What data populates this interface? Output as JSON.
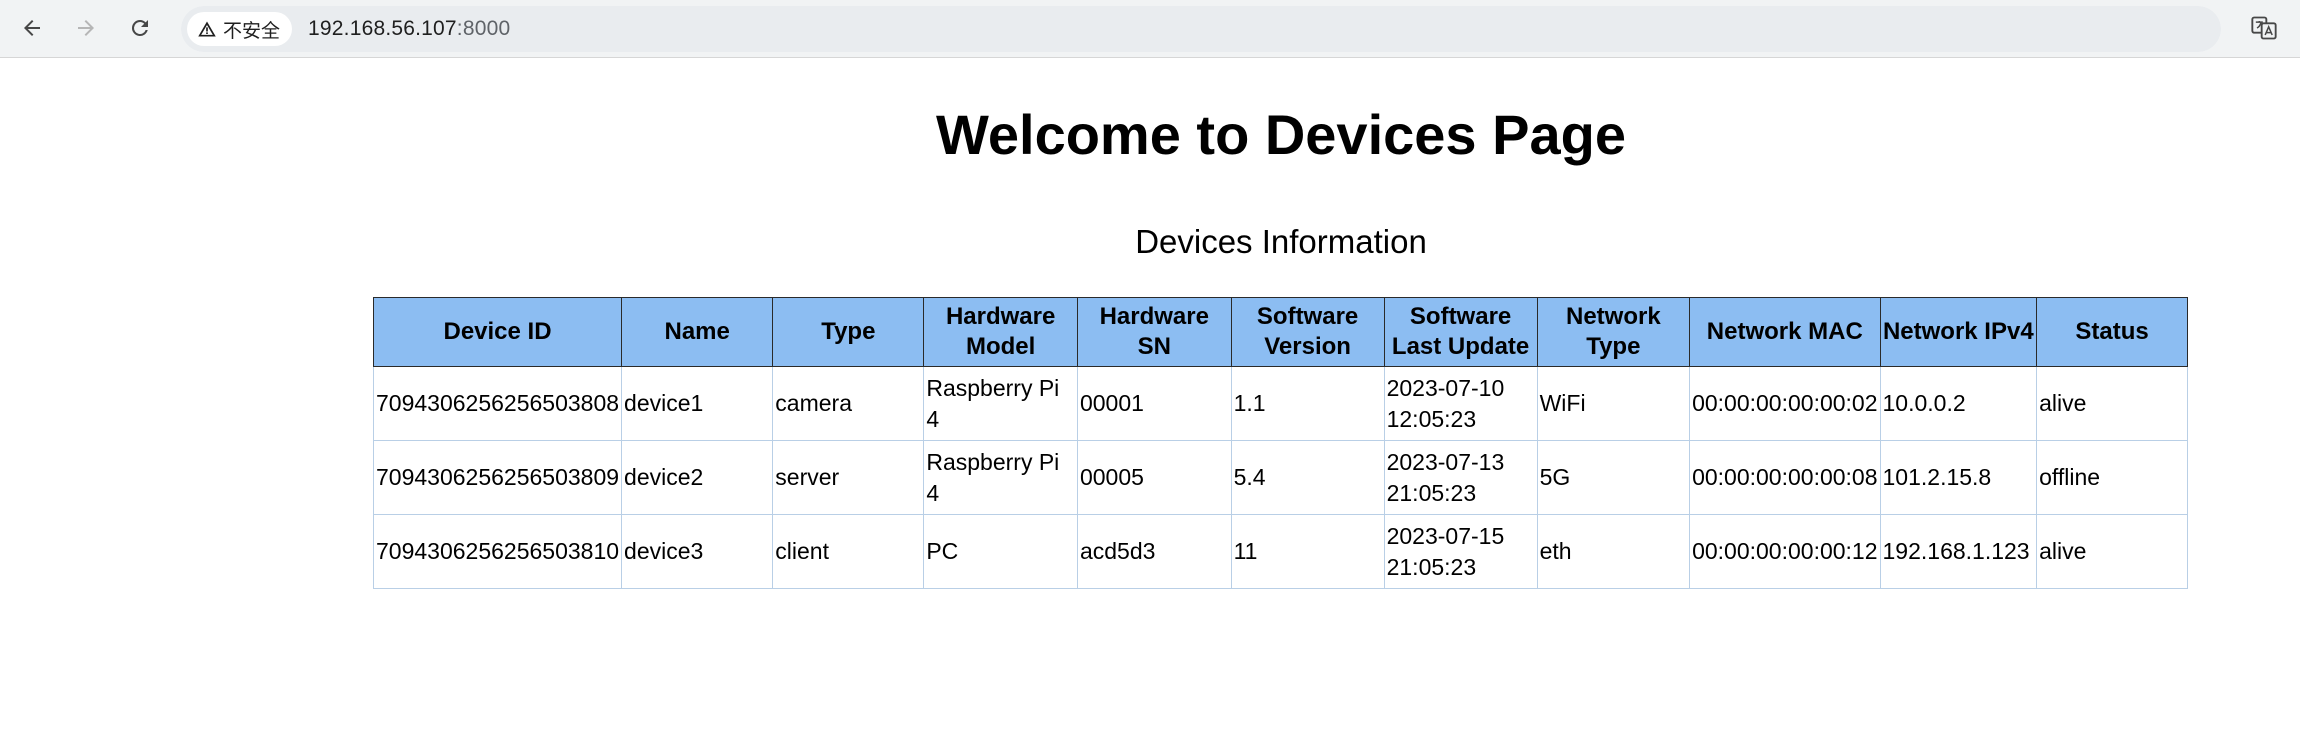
{
  "browser": {
    "security_label": "不安全",
    "url_host": "192.168.56.107",
    "url_port": ":8000",
    "icons": [
      "back-icon",
      "forward-icon",
      "reload-icon",
      "warning-icon",
      "translate-icon"
    ]
  },
  "page": {
    "title": "Welcome to Devices Page",
    "caption": "Devices Information"
  },
  "table": {
    "headers": [
      "Device ID",
      "Name",
      "Type",
      "Hardware Model",
      "Hardware SN",
      "Software Version",
      "Software Last Update",
      "Network Type",
      "Network MAC",
      "Network IPv4",
      "Status"
    ],
    "rows": [
      [
        "7094306256256503808",
        "device1",
        "camera",
        "Raspberry Pi 4",
        "00001",
        "1.1",
        "2023-07-10 12:05:23",
        "WiFi",
        "00:00:00:00:00:02",
        "10.0.0.2",
        "alive"
      ],
      [
        "7094306256256503809",
        "device2",
        "server",
        "Raspberry Pi 4",
        "00005",
        "5.4",
        "2023-07-13 21:05:23",
        "5G",
        "00:00:00:00:00:08",
        "101.2.15.8",
        "offline"
      ],
      [
        "7094306256256503810",
        "device3",
        "client",
        "PC",
        "acd5d3",
        "11",
        "2023-07-15 21:05:23",
        "eth",
        "00:00:00:00:00:12",
        "192.168.1.123",
        "alive"
      ]
    ]
  },
  "colors": {
    "header_bg": "#8cbdf2",
    "header_border": "#2a2a2a",
    "cell_border": "#b9cfe6",
    "toolbar_bg": "#f1f3f4"
  }
}
